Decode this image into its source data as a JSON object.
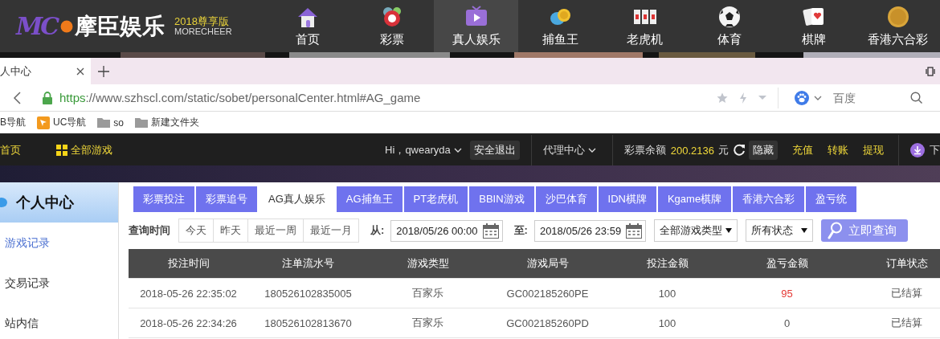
{
  "site_header": {
    "logo": {
      "mark": "MC",
      "name": "摩臣娱乐",
      "edition": "2018尊享版",
      "brand": "MORECHEER"
    },
    "nav": [
      {
        "label": "首页",
        "selected": false
      },
      {
        "label": "彩票",
        "selected": false
      },
      {
        "label": "真人娱乐",
        "selected": true
      },
      {
        "label": "捕鱼王",
        "selected": false
      },
      {
        "label": "老虎机",
        "selected": false
      },
      {
        "label": "体育",
        "selected": false
      },
      {
        "label": "棋牌",
        "selected": false
      },
      {
        "label": "香港六合彩",
        "selected": false
      }
    ]
  },
  "browser": {
    "tab": {
      "title": "人中心"
    },
    "address": {
      "scheme": "https",
      "rest": "://www.szhscl.com/static/sobet/personalCenter.html#AG_game"
    },
    "search": {
      "placeholder": "百度"
    },
    "bookmarks": [
      {
        "label": "B导航",
        "kind": "plain"
      },
      {
        "label": "UC导航",
        "kind": "uc"
      },
      {
        "label": "so",
        "kind": "folder"
      },
      {
        "label": "新建文件夹",
        "kind": "folder"
      }
    ]
  },
  "toolbar": {
    "home": "首页",
    "all_games": "全部游戏",
    "greeting": "Hi，qwearyda",
    "logout": "安全退出",
    "agent": "代理中心",
    "balance_label": "彩票余额",
    "balance": "200.2136",
    "currency": "元",
    "hide": "隐藏",
    "actions": [
      "充值",
      "转账",
      "提现"
    ],
    "download": "下"
  },
  "sidebar": {
    "title": "个人中心",
    "items": [
      {
        "label": "游戏记录",
        "selected": true
      },
      {
        "label": "交易记录",
        "selected": false
      },
      {
        "label": "站内信",
        "selected": false
      }
    ]
  },
  "tabs": [
    {
      "label": "彩票投注",
      "selected": false
    },
    {
      "label": "彩票追号",
      "selected": false
    },
    {
      "label": "AG真人娱乐",
      "selected": true
    },
    {
      "label": "AG捕鱼王",
      "selected": false
    },
    {
      "label": "PT老虎机",
      "selected": false
    },
    {
      "label": "BBIN游戏",
      "selected": false
    },
    {
      "label": "沙巴体育",
      "selected": false
    },
    {
      "label": "IDN棋牌",
      "selected": false
    },
    {
      "label": "Kgame棋牌",
      "selected": false
    },
    {
      "label": "香港六合彩",
      "selected": false
    },
    {
      "label": "盈亏统",
      "selected": false
    }
  ],
  "filters": {
    "label": "查询时间",
    "quick": [
      "今天",
      "昨天",
      "最近一周",
      "最近一月"
    ],
    "from_label": "从:",
    "from": "2018/05/26 00:00",
    "to_label": "至:",
    "to": "2018/05/26 23:59",
    "game_type": "全部游戏类型",
    "status": "所有状态",
    "search_button": "立即查询"
  },
  "table": {
    "columns": [
      "投注时间",
      "注单流水号",
      "游戏类型",
      "游戏局号",
      "投注金额",
      "盈亏金额",
      "订单状态"
    ],
    "rows": [
      {
        "cells": [
          "2018-05-26 22:35:02",
          "180526102835005",
          "百家乐",
          "GC002185260PE",
          "100",
          "95",
          "已结算"
        ],
        "color": "#e53935"
      },
      {
        "cells": [
          "2018-05-26 22:34:26",
          "180526102813670",
          "百家乐",
          "GC002185260PD",
          "100",
          "0",
          "已结算"
        ],
        "color": "#555555"
      }
    ]
  }
}
